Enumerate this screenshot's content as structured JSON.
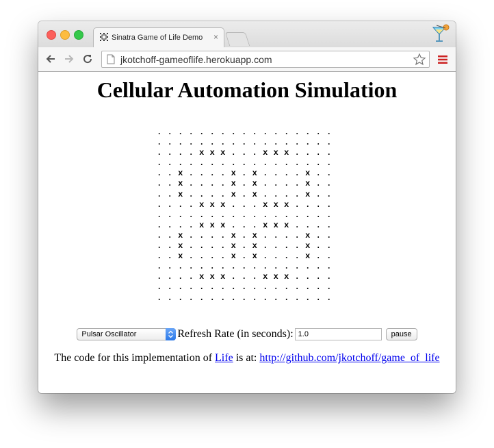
{
  "browser": {
    "tab_title": "Sinatra Game of Life Demo",
    "tab_close": "×",
    "url": "jkotchoff-gameoflife.herokuapp.com"
  },
  "page": {
    "heading": "Cellular Automation Simulation",
    "grid_rows": [
      ". . . . . . . . . . . . . . . . .",
      ". . . . . . . . . . . . . . . . .",
      ". . . . x x x . . . x x x . . . .",
      ". . . . . . . . . . . . . . . . .",
      ". . x . . . . x . x . . . . x . .",
      ". . x . . . . x . x . . . . x . .",
      ". . x . . . . x . x . . . . x . .",
      ". . . . x x x . . . x x x . . . .",
      ". . . . . . . . . . . . . . . . .",
      ". . . . x x x . . . x x x . . . .",
      ". . x . . . . x . x . . . . x . .",
      ". . x . . . . x . x . . . . x . .",
      ". . x . . . . x . x . . . . x . .",
      ". . . . . . . . . . . . . . . . .",
      ". . . . x x x . . . x x x . . . .",
      ". . . . . . . . . . . . . . . . .",
      ". . . . . . . . . . . . . . . . ."
    ],
    "pattern_selected": "Pulsar Oscillator",
    "refresh_label": "Refresh Rate (in seconds):",
    "refresh_value": "1.0",
    "pause_label": "pause",
    "footer_prefix": "The code for this implementation of",
    "footer_link_life": "Life",
    "footer_mid": "is at:",
    "footer_link_repo": "http://github.com/jkotchoff/game_of_life"
  },
  "colors": {
    "link": "#0000ee",
    "select_arrow": "#2a78e8",
    "menu_icon": "#cc2222"
  },
  "icons": [
    "close-icon",
    "minimize-icon",
    "maximize-icon",
    "game-of-life-favicon",
    "back-arrow-icon",
    "forward-arrow-icon",
    "reload-icon",
    "page-icon",
    "star-icon",
    "menu-icon",
    "cocktail-profile-icon"
  ]
}
